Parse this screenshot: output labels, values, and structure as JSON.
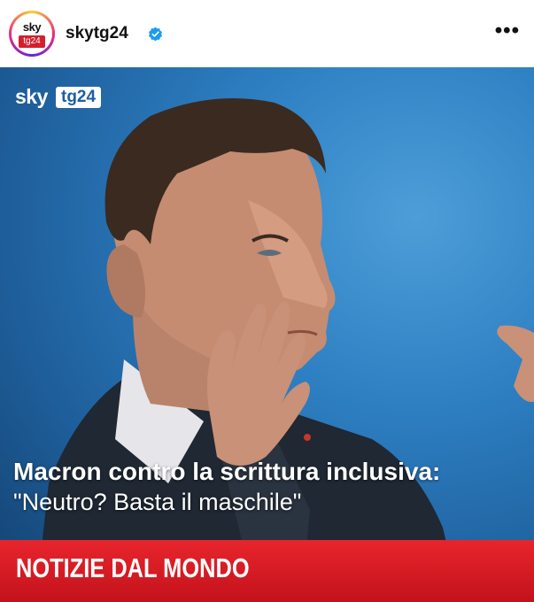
{
  "account": {
    "username": "skytg24",
    "avatar_sky": "sky",
    "avatar_tg": "tg24",
    "verified_icon": "verified-badge-icon",
    "more_icon": "more-options-icon",
    "more_glyph": "•••"
  },
  "post": {
    "brand_sky": "sky",
    "brand_tg": "tg24",
    "headline_line1": "Macron contro la scrittura inclusiva:",
    "headline_line2": "\"Neutro? Basta il maschile\"",
    "banner": "NOTIZIE DAL MONDO"
  },
  "colors": {
    "brand_red": "#d61f2c",
    "brand_blue": "#1b5fa6",
    "verified_blue": "#1d9bf0",
    "banner_red": "#e0222b"
  }
}
